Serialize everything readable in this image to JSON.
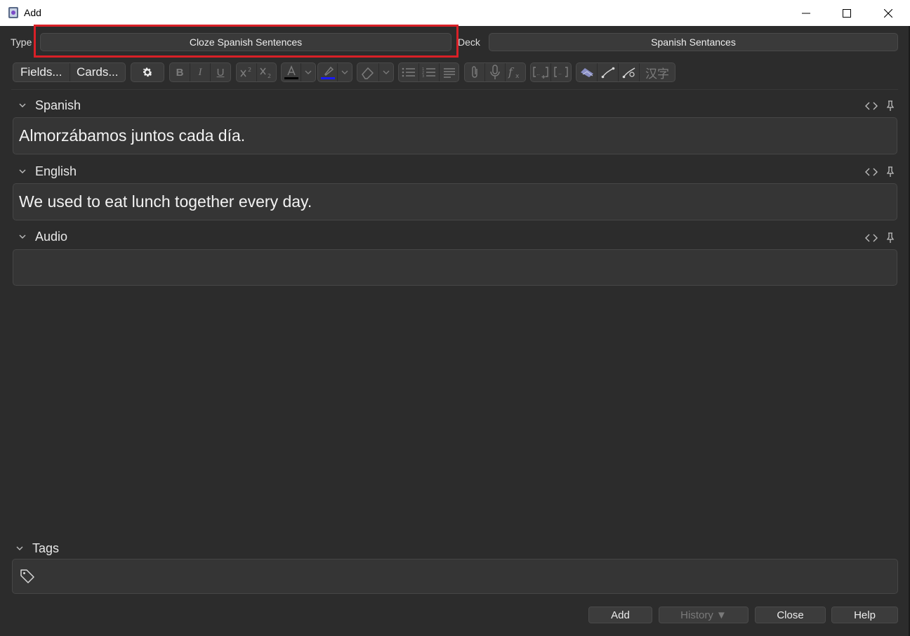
{
  "window": {
    "title": "Add",
    "icon": "anki-app-icon"
  },
  "type_row": {
    "type_label": "Type",
    "type_value": "Cloze Spanish Sentences",
    "deck_label": "Deck",
    "deck_value": "Spanish Sentances"
  },
  "toolbar": {
    "fields_label": "Fields...",
    "cards_label": "Cards...",
    "icons": [
      "gear-icon",
      "bold-icon",
      "italic-icon",
      "underline-icon",
      "superscript-icon",
      "subscript-icon",
      "text-color-icon",
      "highlight-color-icon",
      "eraser-icon",
      "bullet-list-icon",
      "numbered-list-icon",
      "align-icon",
      "paperclip-icon",
      "microphone-icon",
      "function-icon",
      "cloze-add-icon",
      "cloze-icon",
      "image-occlusion-icon",
      "edit-path-icon",
      "path-nodes-icon",
      "chinese-characters-icon"
    ],
    "bold": "B",
    "italic": "I",
    "underline": "U",
    "chinese": "汉字",
    "text_color": "#000000",
    "highlight_color": "#1a1aff"
  },
  "fields": [
    {
      "label": "Spanish",
      "value": "Almorzábamos juntos cada día."
    },
    {
      "label": "English",
      "value": "We used to eat lunch together every day."
    },
    {
      "label": "Audio",
      "value": ""
    }
  ],
  "tags": {
    "label": "Tags",
    "icon": "tag-icon"
  },
  "buttons": {
    "add": "Add",
    "history": "History ▼",
    "close": "Close",
    "help": "Help"
  },
  "colors": {
    "background": "#2c2c2c",
    "highlight_border": "#d92027"
  }
}
